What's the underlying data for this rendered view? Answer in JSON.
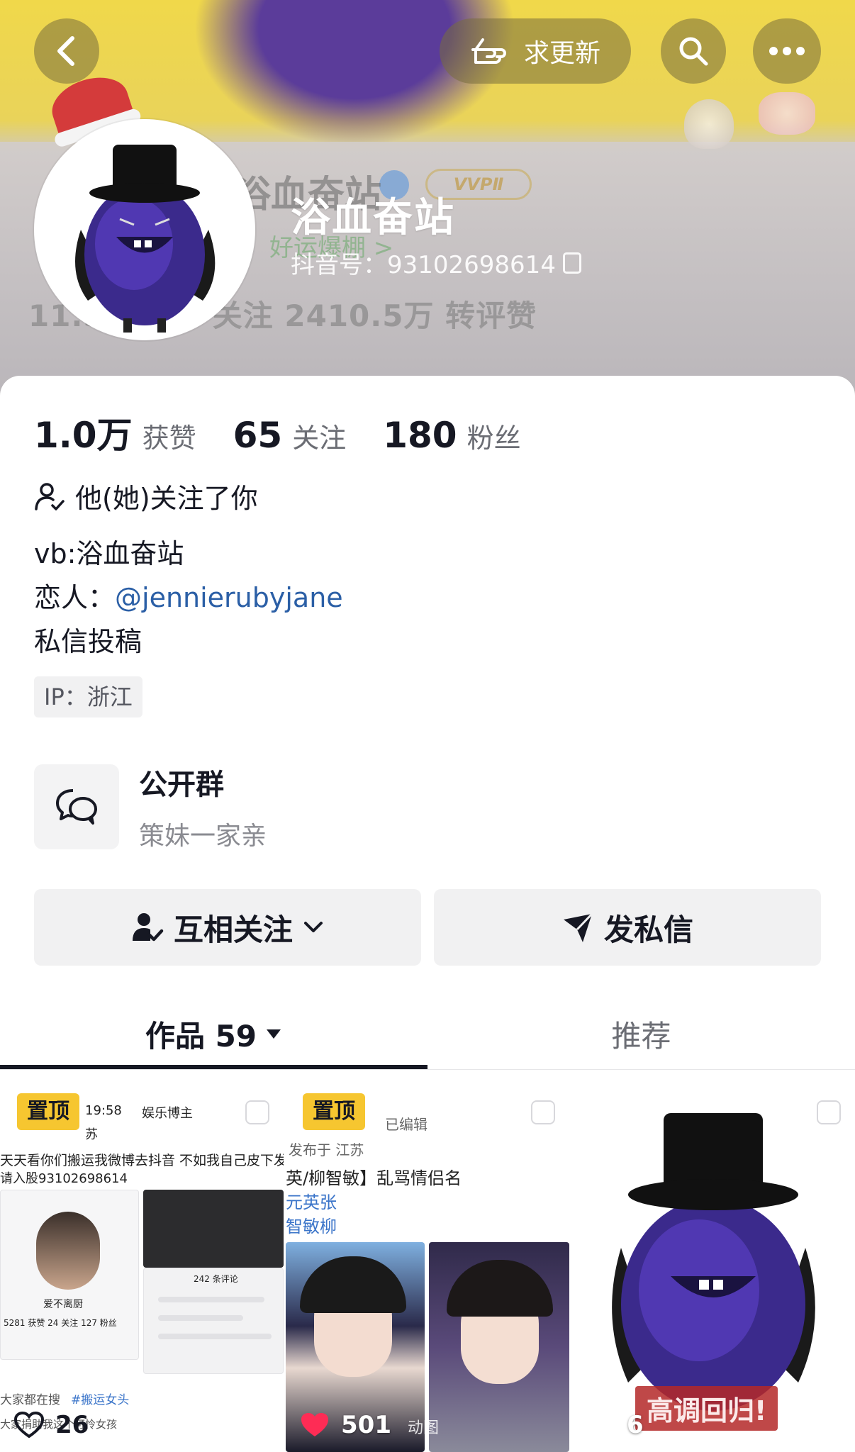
{
  "header": {
    "update_label": "求更新",
    "display_name": "浴血奋站",
    "douyin_id": "抖音号：93102698614",
    "background_ghost": {
      "name": "浴血奋站",
      "vip": "VVPⅡ",
      "luck": "好运爆棚 >",
      "stats": "11.5  2143 关注  2410.5万 转评赞"
    }
  },
  "stats": [
    {
      "value": "1.0万",
      "label": "获赞"
    },
    {
      "value": "65",
      "label": "关注"
    },
    {
      "value": "180",
      "label": "粉丝"
    }
  ],
  "follow_note": "他(她)关注了你",
  "bio": {
    "line1": "vb:浴血奋站",
    "line2_prefix": "恋人：",
    "line2_mention": "@jennierubyjane",
    "line3": "私信投稿"
  },
  "ip": "IP：浙江",
  "group": {
    "title": "公开群",
    "subtitle": "策妹一家亲"
  },
  "actions": {
    "mutual_follow": "互相关注",
    "send_message": "发私信"
  },
  "tabs": {
    "works": "作品 59",
    "recommend": "推荐"
  },
  "videos": [
    {
      "pinned": "置顶",
      "likes": "26",
      "snippets": {
        "time": "19:58",
        "tag": "娱乐博主",
        "location": "苏",
        "caption": "天天看你们搬运我微博去抖音 不如我自己皮下发",
        "caption2": "请入股93102698614",
        "nick": "爱不离厨",
        "search": "大家都在搜",
        "hashtag": "#搬运女头",
        "footer": "大家捐助我这个可怜女孩",
        "comments": "242 条评论",
        "stats_row": "5281 获赞  24 关注  127 粉丝"
      }
    },
    {
      "pinned": "置顶",
      "likes": "501",
      "motion": "动图",
      "snippets": {
        "edited": "已编辑",
        "location": "发布于 江苏",
        "title": "英/柳智敏】乱骂情侣名",
        "blue1": "元英张",
        "blue2": "智敏柳"
      }
    },
    {
      "likes": "6",
      "caption": "高调回归!"
    }
  ],
  "colors": {
    "accent_blue": "#2b5fa6",
    "pin_yellow": "#f6c630",
    "like_red": "#fe2c55",
    "text_primary": "#161823",
    "text_secondary": "#6b6d74"
  }
}
